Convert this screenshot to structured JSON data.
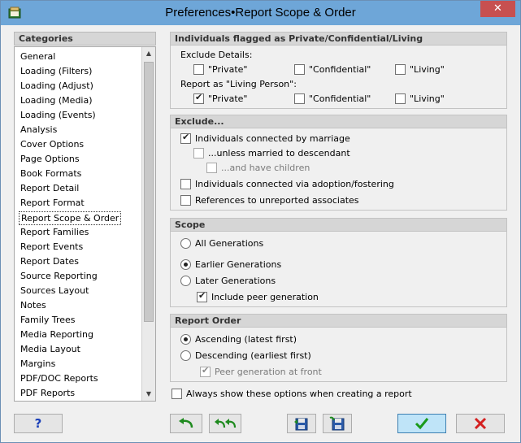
{
  "window": {
    "title": "Preferences•Report Scope & Order",
    "close": "✕"
  },
  "categories": {
    "header": "Categories",
    "items": [
      "General",
      "Loading (Filters)",
      "Loading (Adjust)",
      "Loading (Media)",
      "Loading (Events)",
      "Analysis",
      "Cover Options",
      "Page Options",
      "Book Formats",
      "Report Detail",
      "Report Format",
      "Report Scope & Order",
      "Report Families",
      "Report Events",
      "Report Dates",
      "Source Reporting",
      "Sources Layout",
      "Notes",
      "Family Trees",
      "Media Reporting",
      "Media Layout",
      "Margins",
      "PDF/DOC Reports",
      "PDF Reports"
    ],
    "selected": "Report Scope & Order"
  },
  "private": {
    "title": "Individuals flagged as Private/Confidential/Living",
    "exclude_label": "Exclude Details:",
    "exclude_options": [
      "\"Private\"",
      "\"Confidential\"",
      "\"Living\""
    ],
    "living_label": "Report as \"Living Person\":",
    "living_options": [
      "\"Private\"",
      "\"Confidential\"",
      "\"Living\""
    ]
  },
  "exclude": {
    "title": "Exclude...",
    "marriage": "Individuals connected by marriage",
    "unless": "...unless married to descendant",
    "children": "...and have children",
    "adoption": "Individuals connected via adoption/fostering",
    "unreported": "References to unreported associates"
  },
  "scope": {
    "title": "Scope",
    "all": "All Generations",
    "earlier": "Earlier Generations",
    "later": "Later Generations",
    "peer": "Include peer generation"
  },
  "order": {
    "title": "Report Order",
    "ascending": "Ascending (latest first)",
    "descending": "Descending (earliest first)",
    "peer_front": "Peer generation at front"
  },
  "always_show": "Always show these options when creating a report",
  "buttons": {
    "help": "?"
  },
  "colors": {
    "titlebar": "#6ea6d8",
    "ok_green": "#1a9a1a",
    "cancel_red": "#d42020",
    "help_blue": "#1a3fb8"
  }
}
